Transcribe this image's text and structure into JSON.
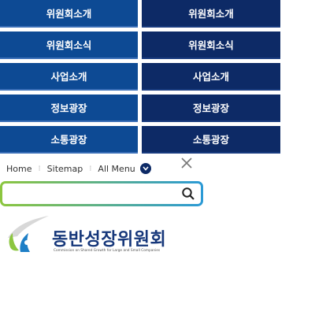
{
  "menu": {
    "left": [
      "위원회소개",
      "위원회소식",
      "사업소개",
      "정보광장",
      "소통광장"
    ],
    "right": [
      "위원회소개",
      "위원회소식",
      "사업소개",
      "정보광장",
      "소통광장"
    ]
  },
  "utility": {
    "home": "Home",
    "sitemap": "Sitemap",
    "all_menu": "All Menu"
  },
  "search": {
    "value": "",
    "placeholder": ""
  },
  "logo": {
    "title": "동반성장위원회",
    "subtitle": "Commission on Shared Growth for Large and Small Companies"
  },
  "colors": {
    "menu_left": "#0d4a94",
    "menu_right": "#0d2a66",
    "search_gradient_start": "#8cc63f",
    "search_gradient_end": "#2b9ad6"
  },
  "icons": [
    "chevron-down-icon",
    "close-icon",
    "search-icon"
  ]
}
